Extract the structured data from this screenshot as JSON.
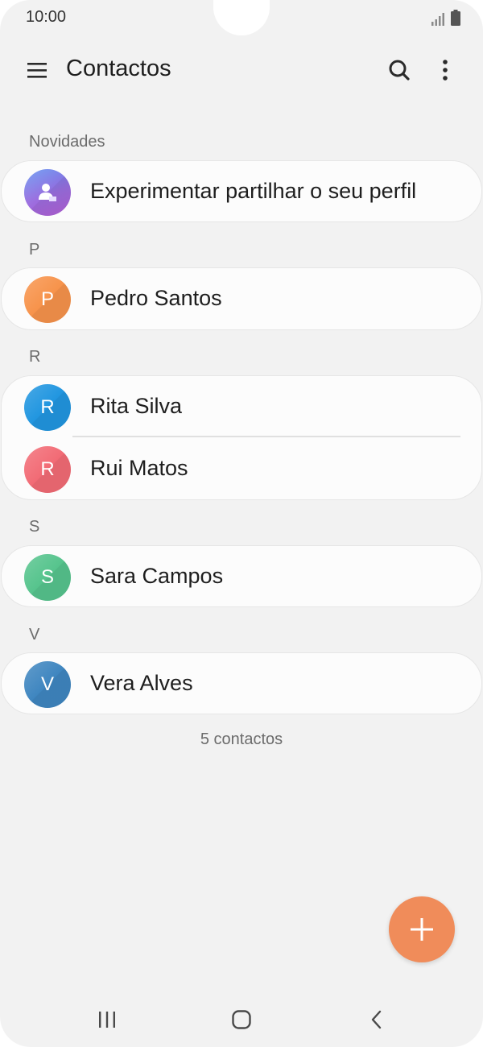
{
  "status_bar": {
    "time": "10:00"
  },
  "app_bar": {
    "title": "Contactos"
  },
  "sections": [
    {
      "header": "Novidades",
      "items": [
        {
          "label": "Experimentar partilhar o seu perfil",
          "avatar_icon": "profile-share-icon",
          "avatar_color": "#8f6fe0"
        }
      ]
    },
    {
      "header": "P",
      "items": [
        {
          "label": "Pedro Santos",
          "initial": "P",
          "avatar_color": "#f7934b"
        }
      ]
    },
    {
      "header": "R",
      "items": [
        {
          "label": "Rita Silva",
          "initial": "R",
          "avatar_color": "#2196e0"
        },
        {
          "label": "Rui Matos",
          "initial": "R",
          "avatar_color": "#f26b75"
        }
      ]
    },
    {
      "header": "S",
      "items": [
        {
          "label": "Sara Campos",
          "initial": "S",
          "avatar_color": "#56c48d"
        }
      ]
    },
    {
      "header": "V",
      "items": [
        {
          "label": "Vera Alves",
          "initial": "V",
          "avatar_color": "#3f86c0"
        }
      ]
    }
  ],
  "footer": {
    "count_text": "5 contactos"
  },
  "fab": {
    "icon": "plus-icon",
    "color": "#f08c5a"
  },
  "nav_bar": {
    "icons": [
      "recents-icon",
      "home-icon",
      "back-icon"
    ]
  }
}
